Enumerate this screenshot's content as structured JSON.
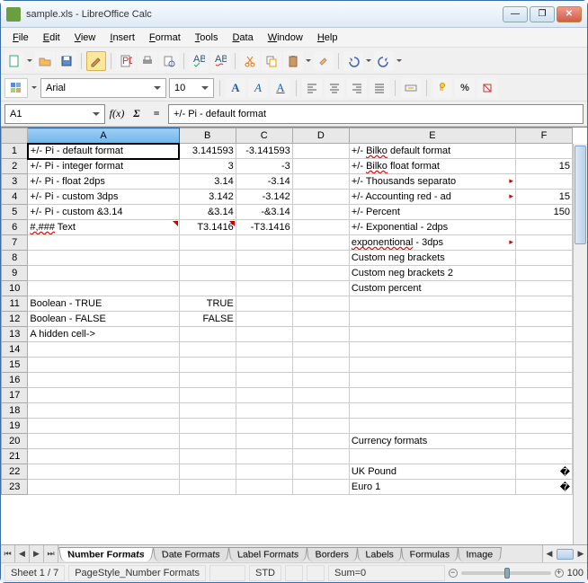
{
  "window": {
    "title": "sample.xls - LibreOffice Calc"
  },
  "menu": [
    "File",
    "Edit",
    "View",
    "Insert",
    "Format",
    "Tools",
    "Data",
    "Window",
    "Help"
  ],
  "toolbar2": {
    "font_name": "Arial",
    "font_size": "10"
  },
  "formula_bar": {
    "cell_ref": "A1",
    "fx": "f(x)",
    "sigma": "Σ",
    "eq": "=",
    "content": "+/- Pi - default format"
  },
  "columns": [
    "A",
    "B",
    "C",
    "D",
    "E",
    "F"
  ],
  "rows": [
    {
      "n": "1",
      "A": "+/- Pi - default format",
      "B": "3.141593",
      "C": "-3.141593",
      "D": "",
      "E": "+/- Bilko default format",
      "E_wave": "Bilko",
      "F": ""
    },
    {
      "n": "2",
      "A": "+/- Pi - integer format",
      "B": "3",
      "C": "-3",
      "D": "",
      "E": "+/- Bilko float format",
      "E_wave": "Bilko",
      "F": "15"
    },
    {
      "n": "3",
      "A": "+/- Pi - float 2dps",
      "B": "3.14",
      "C": "-3.14",
      "D": "",
      "E": "+/- Thousands separato",
      "E_trunc": true,
      "F": ""
    },
    {
      "n": "4",
      "A": "+/- Pi - custom 3dps",
      "B": "3.142",
      "C": "-3.142",
      "D": "",
      "E": "+/- Accounting red - ad",
      "E_trunc": true,
      "F": "15"
    },
    {
      "n": "5",
      "A": "+/- Pi - custom &3.14",
      "B": "&3.14",
      "C": "-&3.14",
      "D": "",
      "E": "+/- Percent",
      "F": "150"
    },
    {
      "n": "6",
      "A": "#,### Text",
      "A_wave": "#,###",
      "A_note": true,
      "B": "T3.1416",
      "B_note": true,
      "C": "-T3.1416",
      "D": "",
      "E": "+/- Exponential - 2dps",
      "F": ""
    },
    {
      "n": "7",
      "A": "",
      "B": "",
      "C": "",
      "D": "",
      "E": "exponentional - 3dps",
      "E_wave": "exponentional",
      "E_trunc": true,
      "F": ""
    },
    {
      "n": "8",
      "A": "",
      "B": "",
      "C": "",
      "D": "",
      "E": "Custom neg brackets",
      "F": ""
    },
    {
      "n": "9",
      "A": "",
      "B": "",
      "C": "",
      "D": "",
      "E": "Custom neg brackets 2",
      "F": ""
    },
    {
      "n": "10",
      "A": "",
      "B": "",
      "C": "",
      "D": "",
      "E": "Custom percent",
      "F": ""
    },
    {
      "n": "11",
      "A": "Boolean - TRUE",
      "B": "TRUE",
      "C": "",
      "D": "",
      "E": "",
      "F": ""
    },
    {
      "n": "12",
      "A": "Boolean - FALSE",
      "B": "FALSE",
      "C": "",
      "D": "",
      "E": "",
      "F": ""
    },
    {
      "n": "13",
      "A": "A hidden cell->",
      "B": "",
      "C": "",
      "D": "",
      "E": "",
      "F": ""
    },
    {
      "n": "14"
    },
    {
      "n": "15"
    },
    {
      "n": "16"
    },
    {
      "n": "17"
    },
    {
      "n": "18"
    },
    {
      "n": "19"
    },
    {
      "n": "20",
      "E": "Currency formats"
    },
    {
      "n": "21"
    },
    {
      "n": "22",
      "E": "UK Pound",
      "F": "�"
    },
    {
      "n": "23",
      "E": "Euro 1",
      "F": "�"
    }
  ],
  "sheet_tabs": [
    "Number Formats",
    "Date Formats",
    "Label Formats",
    "Borders",
    "Labels",
    "Formulas",
    "Image"
  ],
  "active_tab": 0,
  "status": {
    "sheet": "Sheet 1 / 7",
    "pagestyle": "PageStyle_Number Formats",
    "std": "STD",
    "sum": "Sum=0",
    "zoom": "100"
  }
}
